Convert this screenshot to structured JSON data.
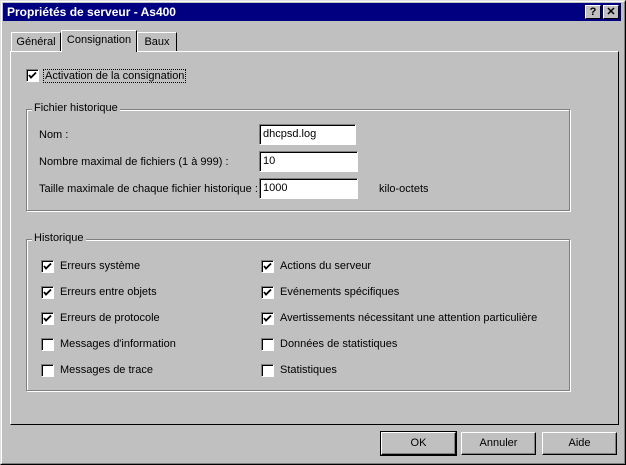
{
  "window": {
    "title": "Propriétés de serveur - As400",
    "help_label": "?",
    "close_label": "✕"
  },
  "tabs": [
    {
      "label": "Général"
    },
    {
      "label": "Consignation"
    },
    {
      "label": "Baux"
    }
  ],
  "logging": {
    "enable_label": "Activation de la consignation",
    "enable_checked": true
  },
  "history_file": {
    "group_title": "Fichier historique",
    "name_label": "Nom :",
    "name_value": "dhcpsd.log",
    "max_files_label": "Nombre maximal de fichiers (1 à 999) :",
    "max_files_value": "10",
    "max_size_label": "Taille maximale de chaque fichier historique :",
    "max_size_value": "1000",
    "max_size_unit": "kilo-octets"
  },
  "history": {
    "group_title": "Historique",
    "left": [
      {
        "label": "Erreurs système",
        "checked": true
      },
      {
        "label": "Erreurs entre objets",
        "checked": true
      },
      {
        "label": "Erreurs de protocole",
        "checked": true
      },
      {
        "label": "Messages d'information",
        "checked": false
      },
      {
        "label": "Messages de trace",
        "checked": false
      }
    ],
    "right": [
      {
        "label": "Actions du serveur",
        "checked": true
      },
      {
        "label": "Evénements spécifiques",
        "checked": true
      },
      {
        "label": "Avertissements nécessitant une attention particulière",
        "checked": true
      },
      {
        "label": "Données de statistiques",
        "checked": false
      },
      {
        "label": "Statistiques",
        "checked": false
      }
    ]
  },
  "buttons": {
    "ok": "OK",
    "cancel": "Annuler",
    "help": "Aide"
  }
}
